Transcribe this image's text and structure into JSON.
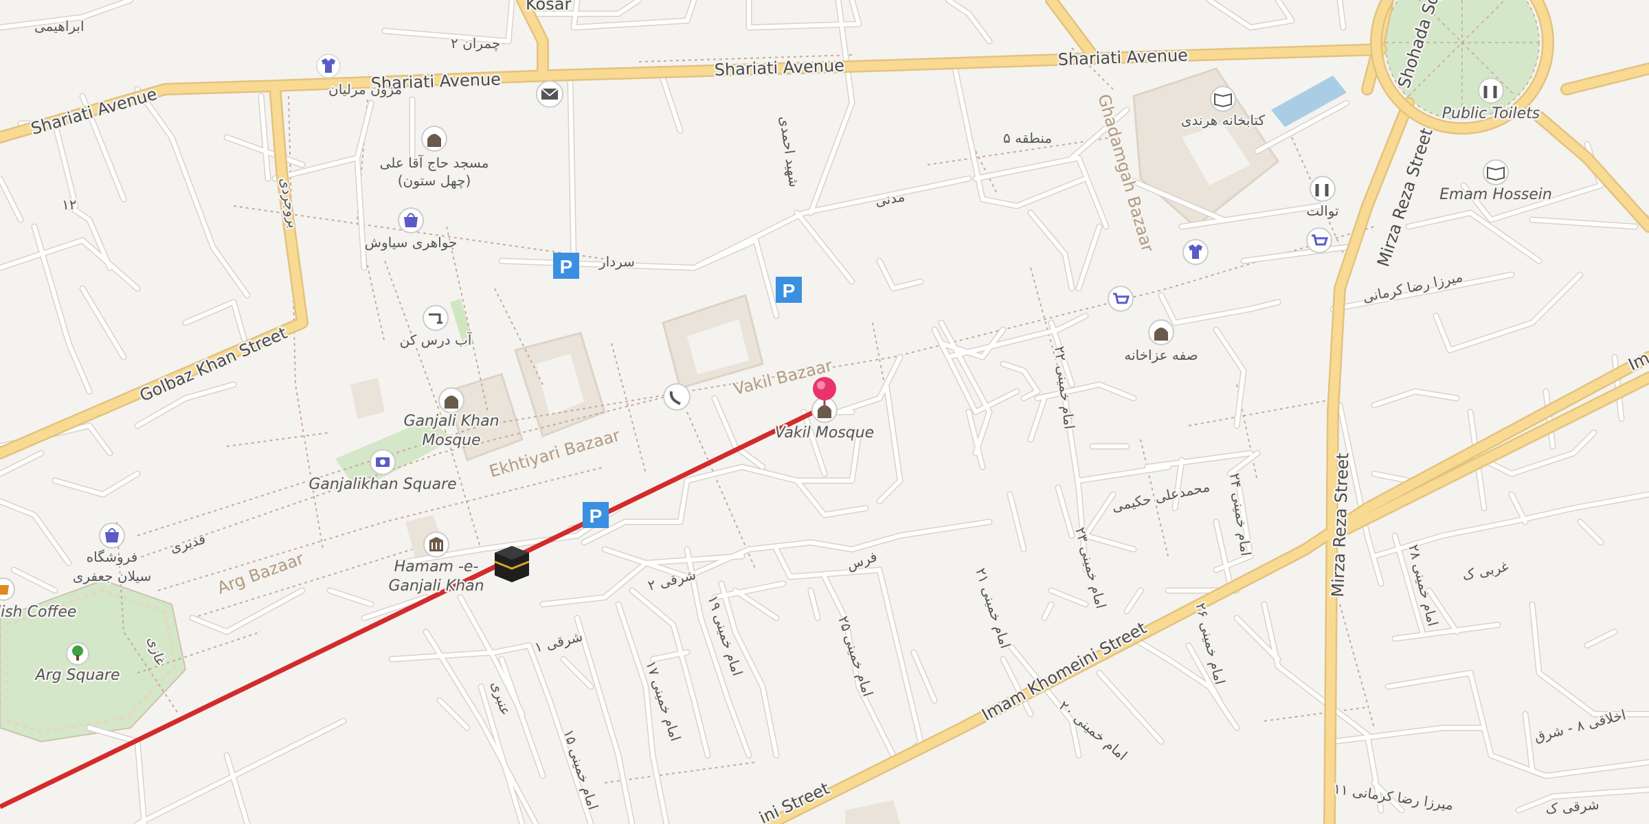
{
  "streets": {
    "shariati_1": "Shariati Avenue",
    "shariati_2": "Shariati Avenue",
    "shariati_3": "Shariati Avenue",
    "shariati_4": "Shariati Avenue",
    "golbaz": "Golbaz Khan Street",
    "mirza_reza_1": "Mirza Reza Street",
    "mirza_reza_2": "Mirza Reza Street",
    "imam_khomeini_1": "Imam Khomeini Street",
    "imam_khomeini_2": "ini Street",
    "shohada": "Shohada Sq",
    "kosar": "Kosar",
    "im_edge": "Im"
  },
  "bazaars": {
    "vakil": "Vakil Bazaar",
    "ekhtiyari": "Ekhtiyari Bazaar",
    "arg": "Arg Bazaar",
    "ghadamgah": "Ghadamgah Bazaar"
  },
  "pois": {
    "public_toilets": "Public Toilets",
    "emam_hossein": "Emam Hossein",
    "vakil_mosque": "Vakil Mosque",
    "ganjali_mosque_1": "Ganjali Khan",
    "ganjali_mosque_2": "Mosque",
    "ganjalikhan_square": "Ganjalikhan Square",
    "hamam_1": "Hamam -e-",
    "hamam_2": "Ganjali Khan",
    "arg_square": "Arg Square",
    "coffee": "lish Coffee"
  },
  "persian": {
    "mezon": "مزون مرلیان",
    "masjed_1": "مسجد حاج آقا علی",
    "masjed_2": "(چهل ستون)",
    "javaheri": "جواهری سیاوش",
    "ab_dars": "آب درس کن",
    "sardar": "سردار",
    "madani": "مدنی",
    "mantaghe": "منطقه ۵",
    "ketabkhaneh": "کتابخانه هرندی",
    "toilet": "توالت",
    "safe": "صفه عزاخانه",
    "foroushgah_1": "فروشگاه",
    "foroushgah_2": "سیلان جعفری",
    "ghadiri": "قدیری",
    "ebrahimi": "ابراهیمی",
    "chamran": "چمران ۲",
    "sharghi2": "شرقی ۲",
    "faras": "فرس",
    "imam19": "امام خمینی ۱۹",
    "imam17": "امام خمینی ۱۷",
    "imam15": "امام خمینی ۱۵",
    "imam21": "امام خمینی ۲۱",
    "imam23": "امام خمینی ۲۳",
    "imam25": "امام خمینی ۲۵",
    "imam22": "امام خمینی ۲۲",
    "imam24": "امام خمینی ۲۴",
    "imam26": "امام خمینی ۲۶",
    "imam28": "امام خمینی ۲۸",
    "imam20": "امام خمینی ۲۰",
    "mohammad": "محمدعلی حکیمی",
    "mirza_kermani_1": "میرزا رضا کرمانی",
    "mirza_kermani_2": "میرزا رضا کرمانی ۱۱",
    "gharbi": "غربی ک",
    "sharghi_k": "شرقی ک",
    "akhlaghi": "اخلاقی ۸ - شرق",
    "shahid": "شهید احمدی",
    "sharghi1": "شرقی ۱",
    "boroudi": "بروجردی",
    "r12": "۱۲",
    "anbari": "عنبری",
    "ghazi": "غازی"
  },
  "route_color": "#d32b2b",
  "icons": {
    "pin": "location-pin-icon",
    "kaaba": "qibla-kaaba-icon",
    "parking": "parking-icon"
  },
  "parking_label": "P"
}
